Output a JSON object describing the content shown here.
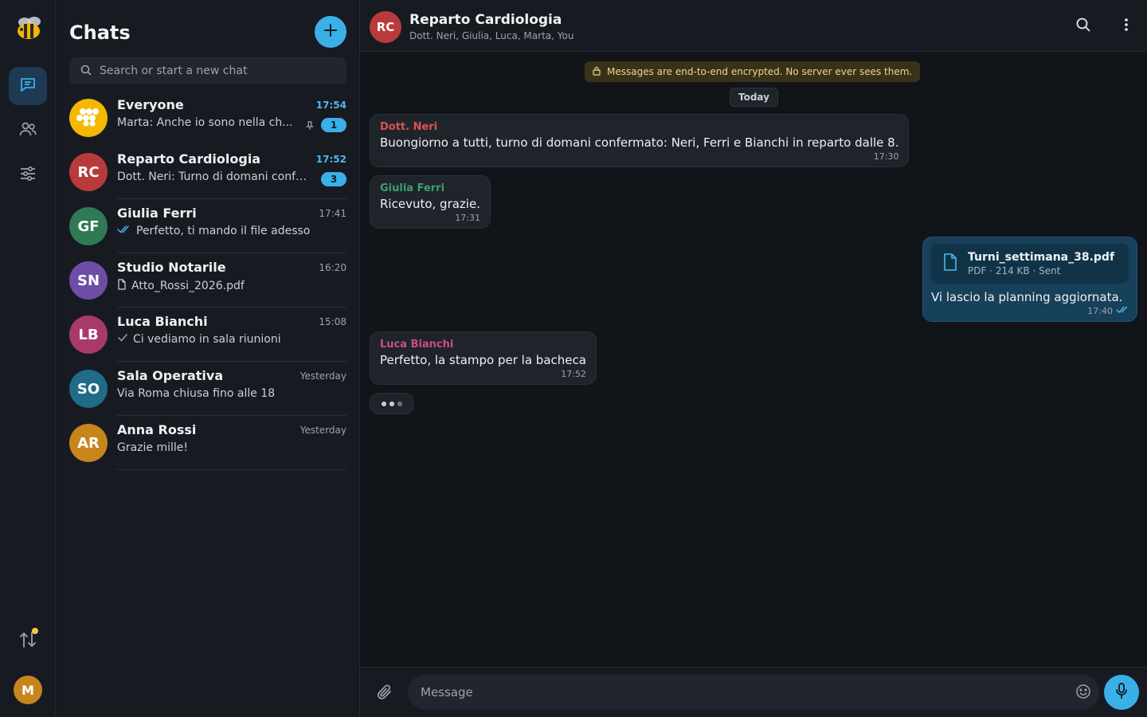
{
  "sidebar": {
    "title": "Chats",
    "search_placeholder": "Search or start a new chat",
    "me_initial": "M",
    "chats": [
      {
        "name": "Everyone",
        "time": "17:54",
        "preview": "Marta: Anche io sono nella ch...",
        "unread": "1",
        "avatar_color": "#f5b800",
        "icon": "honeycomb-icon",
        "pinned": true
      },
      {
        "name": "Reparto Cardiologia",
        "initials": "RC",
        "time": "17:52",
        "preview": "Dott. Neri: Turno di domani confe...",
        "unread": "3",
        "avatar_color": "#b83a3a"
      },
      {
        "name": "Giulia Ferri",
        "initials": "GF",
        "time": "17:41",
        "preview": "Perfetto, ti mando il file adesso",
        "avatar_color": "#2f7a55",
        "status": "double-check-icon"
      },
      {
        "name": "Studio Notarile",
        "initials": "SN",
        "time": "16:20",
        "preview": "Atto_Rossi_2026.pdf",
        "avatar_color": "#6c4ea8",
        "status": "file-icon"
      },
      {
        "name": "Luca Bianchi",
        "initials": "LB",
        "time": "15:08",
        "preview": "Ci vediamo in sala riunioni",
        "avatar_color": "#a83a6a",
        "status": "check-icon"
      },
      {
        "name": "Sala Operativa",
        "initials": "SO",
        "time": "Yesterday",
        "preview": "Via Roma chiusa fino alle 18",
        "avatar_color": "#1f6b8a"
      },
      {
        "name": "Anna Rossi",
        "initials": "AR",
        "time": "Yesterday",
        "preview": "Grazie mille!",
        "avatar_color": "#c8851c"
      }
    ]
  },
  "conversation": {
    "initials": "RC",
    "title": "Reparto Cardiologia",
    "members": "Dott. Neri, Giulia, Luca, Marta, You",
    "e2e_notice": "Messages are end-to-end encrypted. No server ever sees them.",
    "day_label": "Today",
    "messages": [
      {
        "sender": "Dott. Neri",
        "sender_color": "#d9534f",
        "text": "Buongiorno a tutti, turno di domani confermato: Neri, Ferri e Bianchi in reparto dalle 8.",
        "time": "17:30"
      },
      {
        "sender": "Giulia Ferri",
        "sender_color": "#3f9e6c",
        "text": "Ricevuto, grazie.",
        "time": "17:31"
      },
      {
        "outgoing": true,
        "file_name": "Turni_settimana_38.pdf",
        "file_meta": "PDF · 214 KB · Sent",
        "text": "Vi lascio la planning aggiornata.",
        "time": "17:40"
      },
      {
        "sender": "Luca Bianchi",
        "sender_color": "#c94d86",
        "text": "Perfetto, la stampo per la bacheca",
        "time": "17:52"
      }
    ],
    "composer_placeholder": "Message"
  },
  "colors": {
    "accent": "#3ab0e8",
    "sync_dot": "#f5c542"
  }
}
